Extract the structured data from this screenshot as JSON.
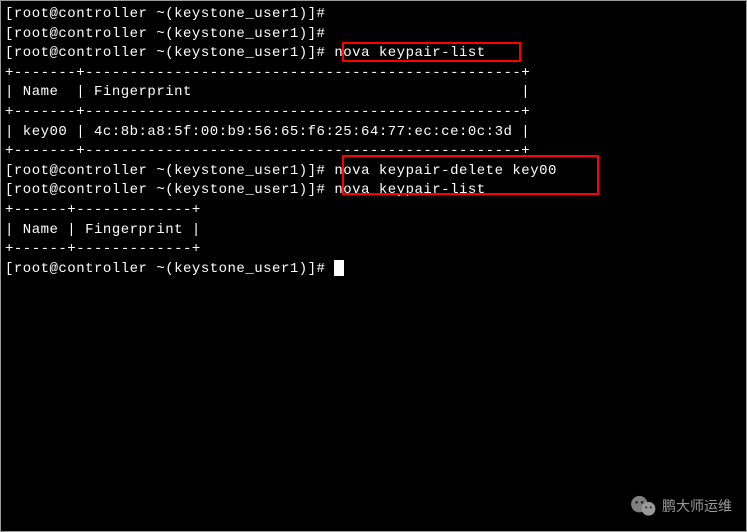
{
  "prompts": [
    "[root@controller ~(keystone_user1)]# ",
    "[root@controller ~(keystone_user1)]# ",
    "[root@controller ~(keystone_user1)]# "
  ],
  "commands": {
    "list1": "nova keypair-list",
    "delete": "nova keypair-delete key00",
    "list2": "nova keypair-list"
  },
  "table1": {
    "border_top": "+-------+-------------------------------------------------+",
    "header": "| Name  | Fingerprint                                     |",
    "border_mid": "+-------+-------------------------------------------------+",
    "row": "| key00 | 4c:8b:a8:5f:00:b9:56:65:f6:25:64:77:ec:ce:0c:3d |",
    "border_bot": "+-------+-------------------------------------------------+"
  },
  "prompts2": [
    "[root@controller ~(keystone_user1)]# ",
    "[root@controller ~(keystone_user1)]# "
  ],
  "table2": {
    "border_top": "+------+-------------+",
    "header": "| Name | Fingerprint |",
    "border_bot": "+------+-------------+"
  },
  "final_prompt": "[root@controller ~(keystone_user1)]# ",
  "watermark": "鹏大师运维"
}
